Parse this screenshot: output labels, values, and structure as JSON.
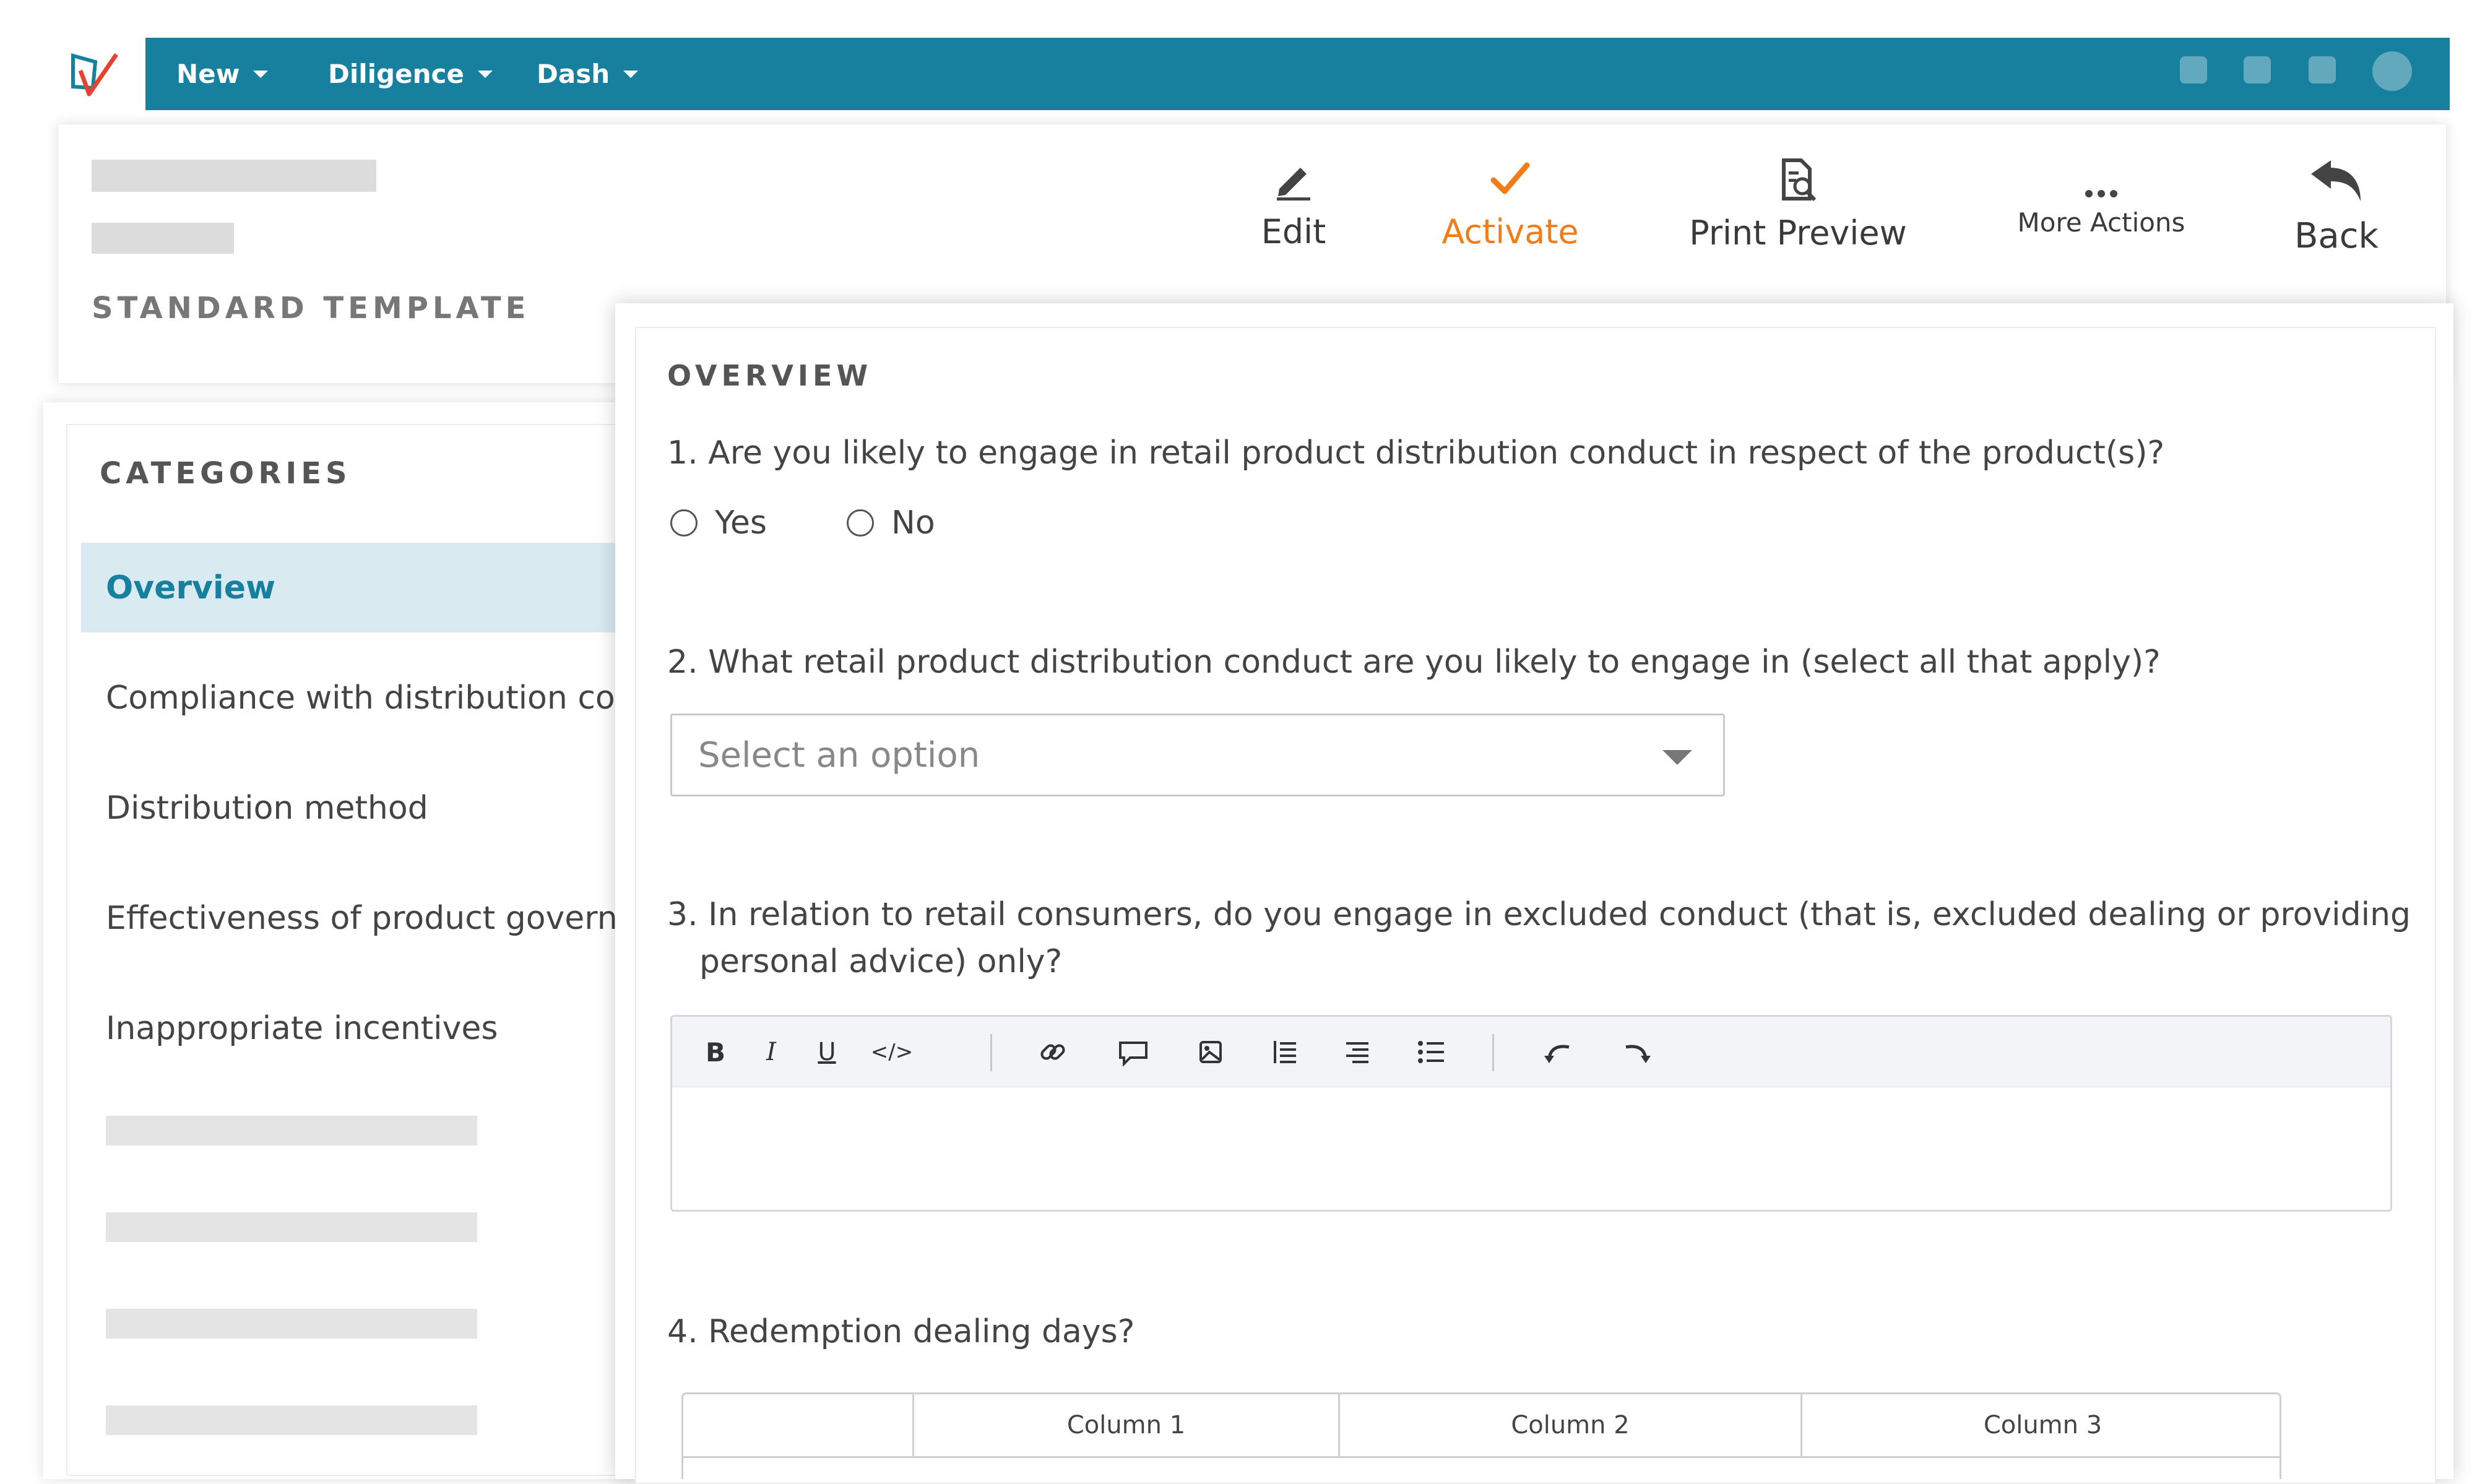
{
  "nav": {
    "menus": [
      {
        "label": "New"
      },
      {
        "label": "Diligence"
      },
      {
        "label": "Dash"
      }
    ]
  },
  "header": {
    "template_label": "STANDARD TEMPLATE",
    "actions": {
      "edit": "Edit",
      "activate": "Activate",
      "print_preview": "Print Preview",
      "more_actions": "More Actions",
      "back": "Back"
    }
  },
  "colors": {
    "nav_bg": "#16809e",
    "accent": "#16809e",
    "activate": "#f07d1a",
    "active_item_bg": "#d9ebf1"
  },
  "categories": {
    "heading": "CATEGORIES",
    "items": [
      {
        "label": "Overview",
        "active": true
      },
      {
        "label": "Compliance with distribution conduct"
      },
      {
        "label": "Distribution method"
      },
      {
        "label": "Effectiveness of product governance"
      },
      {
        "label": "Inappropriate incentives"
      }
    ]
  },
  "overview": {
    "heading": "OVERVIEW",
    "q1": {
      "text": "1. Are you likely to engage in retail product distribution conduct in respect of the product(s)?",
      "options": [
        "Yes",
        "No"
      ]
    },
    "q2": {
      "text": "2. What retail product distribution conduct are you likely to engage in (select all that apply)?",
      "placeholder": "Select an option"
    },
    "q3": {
      "line1": "3. In relation to retail consumers, do you engage in excluded conduct (that is, excluded dealing or providing",
      "line2": "personal advice) only?",
      "toolbar": [
        "bold-icon",
        "italic-icon",
        "underline-icon",
        "code-icon",
        "link-icon",
        "comment-icon",
        "image-icon",
        "ordered-list-icon",
        "align-right-icon",
        "bullet-list-icon",
        "undo-icon",
        "redo-icon"
      ]
    },
    "q4": {
      "text": "4. Redemption dealing days?",
      "columns": [
        "Column 1",
        "Column 2",
        "Column 3"
      ]
    }
  }
}
